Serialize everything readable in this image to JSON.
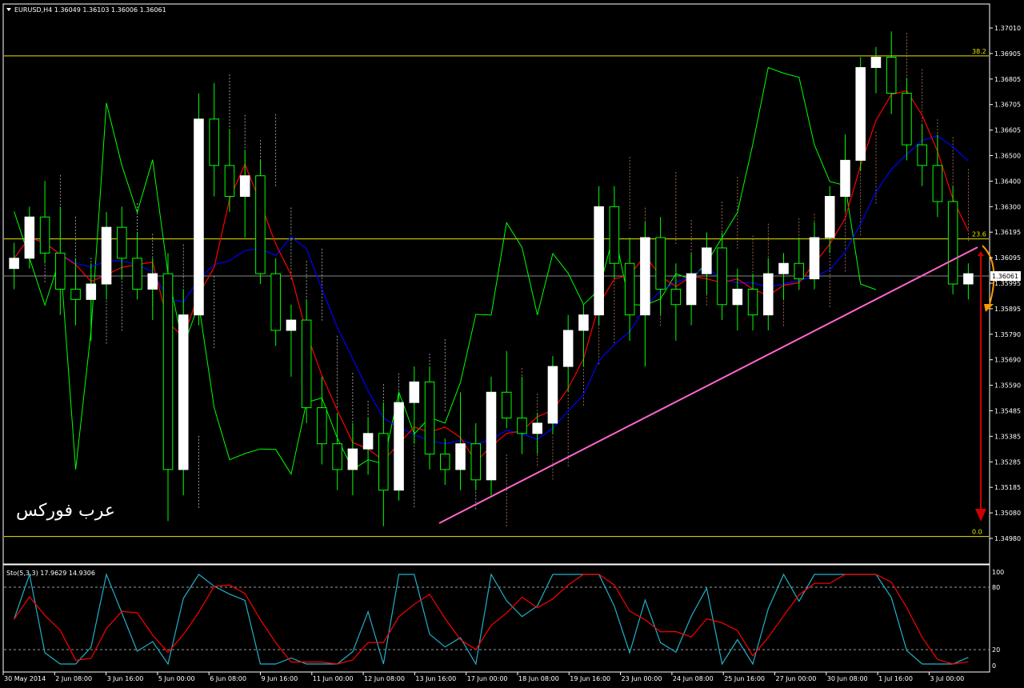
{
  "header": {
    "symbol_line": "EURUSD,H4  1.36049 1.36103 1.36006 1.36061"
  },
  "price_axis": {
    "labels": [
      "1.37010",
      "1.36905",
      "1.36805",
      "1.36705",
      "1.36605",
      "1.36500",
      "1.36400",
      "1.36300",
      "1.36195",
      "1.36095",
      "1.35995",
      "1.35895",
      "1.35790",
      "1.35690",
      "1.35590",
      "1.35485",
      "1.35385",
      "1.35285",
      "1.35185",
      "1.35080",
      "1.34980"
    ],
    "current_price": "1.36061"
  },
  "fibonacci": {
    "levels": [
      {
        "label": "38.2",
        "price": 1.36905
      },
      {
        "label": "23.6",
        "price": 1.36195
      },
      {
        "label": "0.0",
        "price": 1.3504
      }
    ],
    "color": "#e6e600"
  },
  "time_axis": {
    "labels": [
      "30 May 2014",
      "2 Jun 08:00",
      "3 Jun 16:00",
      "5 Jun 00:00",
      "6 Jun 08:00",
      "9 Jun 16:00",
      "11 Jun 00:00",
      "12 Jun 08:00",
      "13 Jun 16:00",
      "17 Jun 00:00",
      "18 Jun 08:00",
      "19 Jun 16:00",
      "23 Jun 00:00",
      "24 Jun 08:00",
      "25 Jun 16:00",
      "27 Jun 00:00",
      "30 Jun 08:00",
      "1 Jul 16:00",
      "3 Jul 00:00"
    ]
  },
  "stochastic": {
    "title": "Sto(5,3,3) 17.9629 14.9306",
    "axis_labels": [
      "100",
      "80",
      "20",
      "0"
    ]
  },
  "watermark": "عرب فوركس",
  "colors": {
    "background": "#000000",
    "bull_candle": "#ffffff",
    "wick": "#00ff00",
    "chikou": "#00ff00",
    "tenkan": "#ff0000",
    "kijun": "#0000ff",
    "trendline": "#ff66cc",
    "arrow_down": "#cc0000",
    "arrow_curve": "#ff9900"
  },
  "chart_data": {
    "type": "candlestick",
    "symbol": "EURUSD",
    "timeframe": "H4",
    "ylim": [
      1.3498,
      1.3706
    ],
    "candles": [
      [
        1.3608,
        1.3618,
        1.36,
        1.3612
      ],
      [
        1.3612,
        1.3632,
        1.3608,
        1.3628
      ],
      [
        1.3628,
        1.3642,
        1.361,
        1.3614
      ],
      [
        1.3614,
        1.3632,
        1.359,
        1.36
      ],
      [
        1.36,
        1.3612,
        1.3586,
        1.3596
      ],
      [
        1.3596,
        1.361,
        1.358,
        1.3602
      ],
      [
        1.3602,
        1.363,
        1.3596,
        1.3624
      ],
      [
        1.3624,
        1.3632,
        1.3604,
        1.3612
      ],
      [
        1.3612,
        1.3622,
        1.3596,
        1.36
      ],
      [
        1.36,
        1.3612,
        1.3588,
        1.3606
      ],
      [
        1.3606,
        1.3614,
        1.351,
        1.353
      ],
      [
        1.353,
        1.36,
        1.352,
        1.359
      ],
      [
        1.359,
        1.3676,
        1.3586,
        1.3666
      ],
      [
        1.3666,
        1.368,
        1.3636,
        1.3648
      ],
      [
        1.3648,
        1.3662,
        1.363,
        1.3636
      ],
      [
        1.3636,
        1.3654,
        1.362,
        1.3644
      ],
      [
        1.3644,
        1.365,
        1.3602,
        1.3606
      ],
      [
        1.3606,
        1.3612,
        1.3578,
        1.3584
      ],
      [
        1.3584,
        1.3594,
        1.3566,
        1.3588
      ],
      [
        1.3588,
        1.3596,
        1.3548,
        1.3554
      ],
      [
        1.3554,
        1.3566,
        1.3532,
        1.354
      ],
      [
        1.354,
        1.3552,
        1.3522,
        1.353
      ],
      [
        1.353,
        1.3548,
        1.352,
        1.3538
      ],
      [
        1.3538,
        1.355,
        1.3528,
        1.3544
      ],
      [
        1.3544,
        1.3556,
        1.3508,
        1.3522
      ],
      [
        1.3522,
        1.356,
        1.3518,
        1.3556
      ],
      [
        1.3556,
        1.357,
        1.354,
        1.3564
      ],
      [
        1.3564,
        1.357,
        1.353,
        1.3536
      ],
      [
        1.3536,
        1.3542,
        1.3524,
        1.353
      ],
      [
        1.353,
        1.356,
        1.3522,
        1.354
      ],
      [
        1.354,
        1.3548,
        1.3522,
        1.3526
      ],
      [
        1.3526,
        1.3566,
        1.352,
        1.356
      ],
      [
        1.356,
        1.3576,
        1.3546,
        1.355
      ],
      [
        1.355,
        1.3566,
        1.3536,
        1.3544
      ],
      [
        1.3544,
        1.3552,
        1.3536,
        1.3548
      ],
      [
        1.3548,
        1.3574,
        1.3544,
        1.357
      ],
      [
        1.357,
        1.359,
        1.356,
        1.3584
      ],
      [
        1.3584,
        1.3594,
        1.357,
        1.359
      ],
      [
        1.359,
        1.364,
        1.3586,
        1.3632
      ],
      [
        1.3632,
        1.364,
        1.3604,
        1.361
      ],
      [
        1.361,
        1.362,
        1.358,
        1.359
      ],
      [
        1.359,
        1.3626,
        1.357,
        1.362
      ],
      [
        1.362,
        1.3628,
        1.359,
        1.36
      ],
      [
        1.36,
        1.361,
        1.358,
        1.3594
      ],
      [
        1.3594,
        1.3614,
        1.3586,
        1.3606
      ],
      [
        1.3606,
        1.3622,
        1.3598,
        1.3616
      ],
      [
        1.3616,
        1.3622,
        1.3588,
        1.3594
      ],
      [
        1.3594,
        1.3608,
        1.3584,
        1.36
      ],
      [
        1.36,
        1.3606,
        1.3584,
        1.359
      ],
      [
        1.359,
        1.3612,
        1.3584,
        1.3606
      ],
      [
        1.3606,
        1.3614,
        1.3596,
        1.361
      ],
      [
        1.361,
        1.362,
        1.36,
        1.3604
      ],
      [
        1.3604,
        1.3626,
        1.36,
        1.362
      ],
      [
        1.362,
        1.364,
        1.3614,
        1.3636
      ],
      [
        1.3636,
        1.366,
        1.363,
        1.365
      ],
      [
        1.365,
        1.369,
        1.3646,
        1.3686
      ],
      [
        1.3686,
        1.3694,
        1.3676,
        1.369
      ],
      [
        1.369,
        1.37,
        1.3668,
        1.3676
      ],
      [
        1.3676,
        1.3682,
        1.365,
        1.3656
      ],
      [
        1.3656,
        1.3664,
        1.364,
        1.3648
      ],
      [
        1.3648,
        1.366,
        1.3628,
        1.3634
      ],
      [
        1.3634,
        1.364,
        1.3598,
        1.3602
      ],
      [
        1.3602,
        1.361,
        1.3596,
        1.3606
      ]
    ]
  }
}
